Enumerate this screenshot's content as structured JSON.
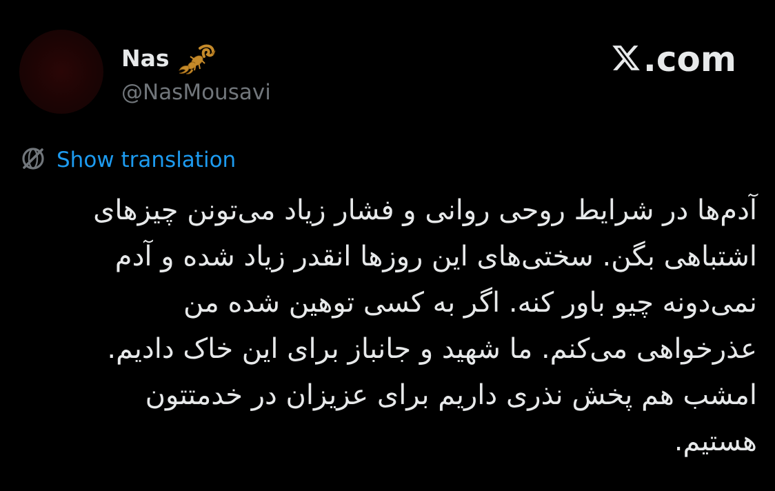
{
  "author": {
    "display_name": "Nas",
    "name_emoji": "scorpion-icon",
    "handle": "@NasMousavi",
    "avatar_color": "#1c0404"
  },
  "brand": {
    "logo_text": ".com",
    "logo_icon": "x-logo-icon"
  },
  "translation": {
    "label": "Show translation",
    "icon": "globe-slash-icon",
    "color": "#1d9bf0"
  },
  "tweet": {
    "text": "آدم‌ها در شرایط روحی روانی و فشار زیاد می‌تونن چیزهای\nاشتباهی بگن. سختی‌های این روزها انقدر زیاد شده و آدم\nنمی‌دونه چیو باور کنه. اگر به کسی توهین شده من\nعذرخواهی می‌کنم. ما شهید و جانباز برای این خاک دادیم.\nامشب هم پخش نذری داریم برای عزیزان در خدمتتون\nهستیم."
  }
}
